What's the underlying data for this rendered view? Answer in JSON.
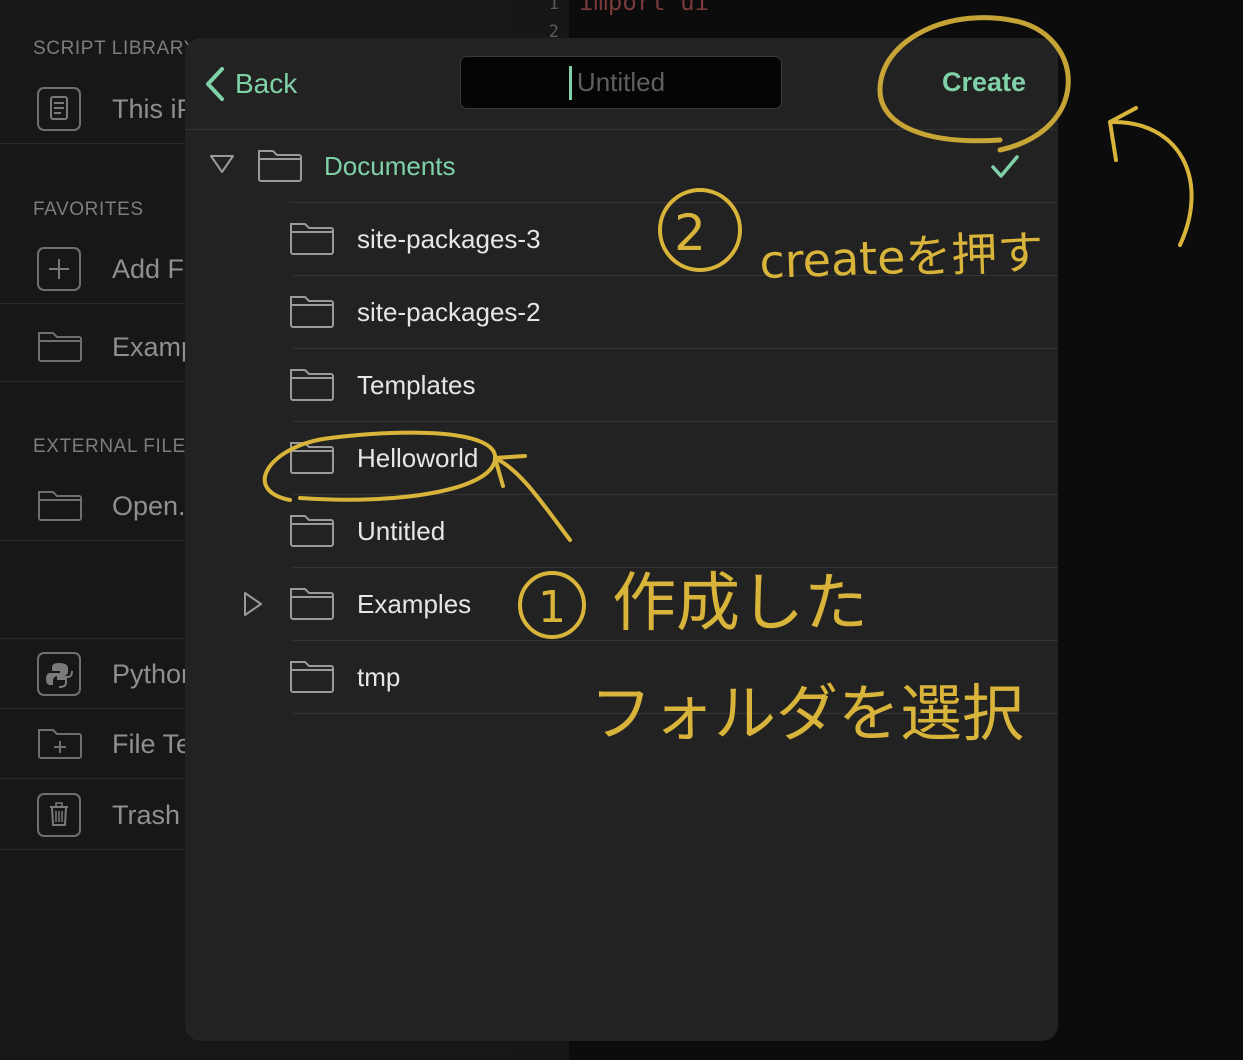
{
  "sidebar": {
    "sections": [
      {
        "header": "SCRIPT LIBRARY",
        "items": [
          {
            "label": "This iPad",
            "icon": "document-icon"
          }
        ]
      },
      {
        "header": "FAVORITES",
        "items": [
          {
            "label": "Add Favorite",
            "icon": "plus-icon"
          },
          {
            "label": "Examples",
            "icon": "folder-icon"
          }
        ]
      },
      {
        "header": "EXTERNAL FILES",
        "items": [
          {
            "label": "Open...",
            "icon": "folder-icon"
          }
        ]
      },
      {
        "header": "",
        "items": [
          {
            "label": "Python Modules",
            "icon": "python-icon"
          },
          {
            "label": "File Templates",
            "icon": "folder-plus-icon"
          },
          {
            "label": "Trash",
            "icon": "trash-icon"
          }
        ]
      }
    ]
  },
  "editor": {
    "line_numbers": [
      "1",
      "2"
    ],
    "code_line_1": "import ui"
  },
  "dialog": {
    "back_label": "Back",
    "name_placeholder": "Untitled",
    "name_value": "",
    "create_label": "Create",
    "root_folder": "Documents",
    "folders": [
      {
        "name": "site-packages-3",
        "expandable": false
      },
      {
        "name": "site-packages-2",
        "expandable": false
      },
      {
        "name": "Templates",
        "expandable": false
      },
      {
        "name": "Helloworld",
        "expandable": false
      },
      {
        "name": "Untitled",
        "expandable": false
      },
      {
        "name": "Examples",
        "expandable": true
      },
      {
        "name": "tmp",
        "expandable": false
      }
    ],
    "accent_color": "#7fd1a8"
  },
  "annotations": {
    "step1_number": "①",
    "step1_line1": "作成した",
    "step1_line2": "フォルダを選択",
    "step2_number": "②",
    "step2_text": "createを押す",
    "ink_color": "#d9b43a"
  }
}
